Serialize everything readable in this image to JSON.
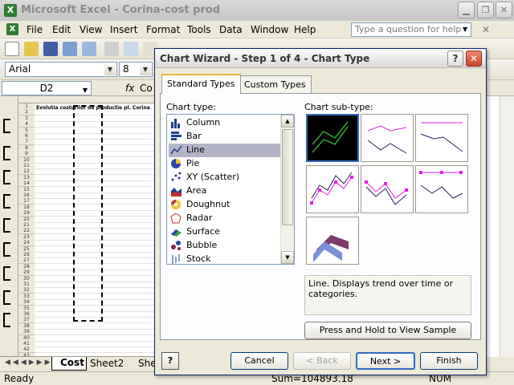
{
  "app": {
    "title": "Microsoft Excel - Corina-cost prod",
    "icon": "excel-icon"
  },
  "menu": [
    "File",
    "Edit",
    "View",
    "Insert",
    "Format",
    "Tools",
    "Data",
    "Window",
    "Help"
  ],
  "question_box": {
    "placeholder": "Type a question for help"
  },
  "toolbar": {
    "font": "Arial",
    "size": "8"
  },
  "formula_bar": {
    "name_box": "D2",
    "fx": "fx",
    "content": "Co"
  },
  "sheet": {
    "header_text": "Evolutia costurilor de productie pl. Corina",
    "row_numbers": [
      "1",
      "2",
      "3",
      "4",
      "5",
      "6",
      "7",
      "8",
      "9",
      "10",
      "11",
      "12",
      "13",
      "14",
      "15",
      "16",
      "17",
      "18",
      "19",
      "20",
      "21",
      "22",
      "23",
      "24",
      "25",
      "26",
      "27",
      "28",
      "29",
      "30",
      "31",
      "32",
      "33",
      "34",
      "35",
      "36",
      "37",
      "38",
      "39",
      "40",
      "41",
      "42",
      "43"
    ]
  },
  "sheet_tabs": [
    "Cost",
    "Sheet2",
    "She"
  ],
  "status": {
    "left": "Ready",
    "sum": "Sum=104893.18",
    "right": "NUM"
  },
  "dialog": {
    "title": "Chart Wizard - Step 1 of 4 - Chart Type",
    "tabs": [
      "Standard Types",
      "Custom Types"
    ],
    "chart_type_label": "Chart type:",
    "chart_subtype_label": "Chart sub-type:",
    "chart_types": [
      {
        "label": "Column",
        "icon": "column-chart-icon"
      },
      {
        "label": "Bar",
        "icon": "bar-chart-icon"
      },
      {
        "label": "Line",
        "icon": "line-chart-icon"
      },
      {
        "label": "Pie",
        "icon": "pie-chart-icon"
      },
      {
        "label": "XY (Scatter)",
        "icon": "scatter-chart-icon"
      },
      {
        "label": "Area",
        "icon": "area-chart-icon"
      },
      {
        "label": "Doughnut",
        "icon": "doughnut-chart-icon"
      },
      {
        "label": "Radar",
        "icon": "radar-chart-icon"
      },
      {
        "label": "Surface",
        "icon": "surface-chart-icon"
      },
      {
        "label": "Bubble",
        "icon": "bubble-chart-icon"
      },
      {
        "label": "Stock",
        "icon": "stock-chart-icon"
      }
    ],
    "selected_type": "Line",
    "description": "Line. Displays trend over time or categories.",
    "sample_button": "Press and Hold to View Sample",
    "buttons": {
      "cancel": "Cancel",
      "back": "< Back",
      "next": "Next >",
      "finish": "Finish"
    }
  },
  "colors": {
    "accent": "#316ac5",
    "selected_bg": "#b4b4c8",
    "close": "#d9534f"
  }
}
